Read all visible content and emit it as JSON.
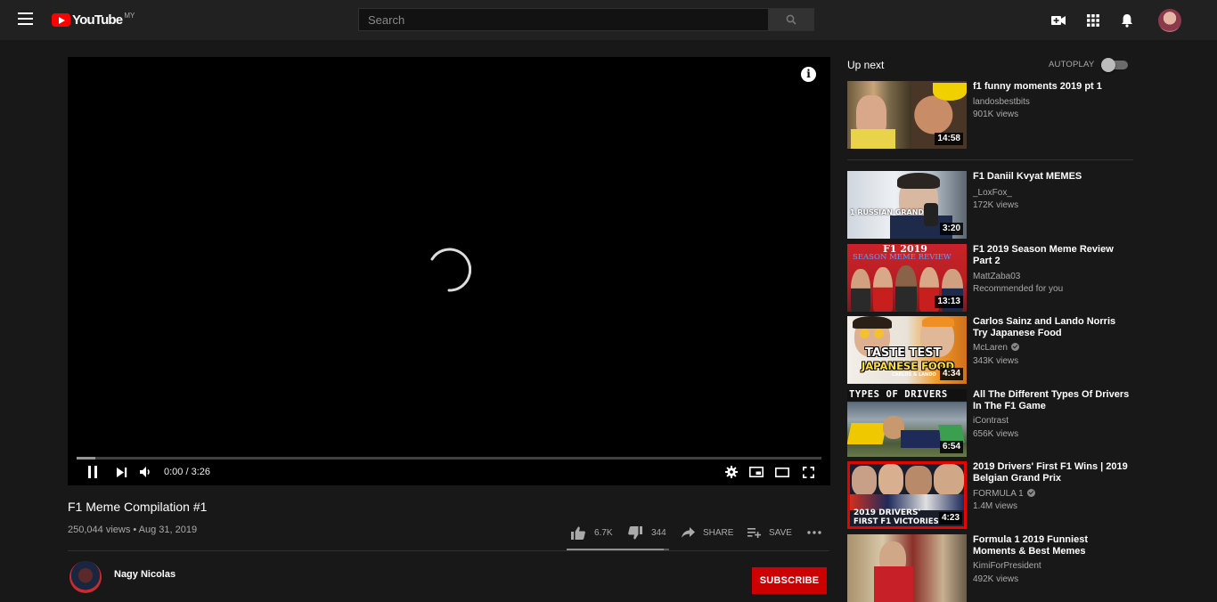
{
  "masthead": {
    "logo_text": "YouTube",
    "logo_region": "MY",
    "search_placeholder": "Search"
  },
  "player": {
    "time_display": "0:00 / 3:26",
    "progress_fraction": 0.0,
    "buffered_fraction": 0.025
  },
  "video": {
    "title": "F1 Meme Compilation #1",
    "meta": "250,044 views • Aug 31, 2019",
    "likes": "6.7K",
    "dislikes": "344",
    "like_ratio": 0.95,
    "share_label": "SHARE",
    "save_label": "SAVE"
  },
  "channel": {
    "name": "Nagy Nicolas",
    "subscribe_label": "SUBSCRIBE"
  },
  "sidebar": {
    "up_next_label": "Up next",
    "autoplay_label": "AUTOPLAY",
    "autoplay_on": false,
    "videos": [
      {
        "title": "f1 funny moments 2019 pt 1",
        "channel": "landosbestbits",
        "verified": false,
        "views": "901K views",
        "extra": "",
        "duration": "14:58"
      },
      {
        "title": "F1 Daniil Kvyat MEMES",
        "channel": "_LoxFox_",
        "verified": false,
        "views": "172K views",
        "extra": "",
        "duration": "3:20",
        "thumb_caption": "1 RUSSIAN GRAND"
      },
      {
        "title": "F1 2019 Season Meme Review Part 2",
        "channel": "MattZaba03",
        "verified": false,
        "views": "Recommended for you",
        "extra": "",
        "duration": "13:13",
        "thumb_caption": "F1 2019",
        "thumb_caption_2": "SEASON MEME REVIEW"
      },
      {
        "title": "Carlos Sainz and Lando Norris Try Japanese Food",
        "channel": "McLaren",
        "verified": true,
        "views": "343K views",
        "extra": "",
        "duration": "4:34",
        "thumb_caption": "TASTE TEST",
        "thumb_caption_2": "JAPANESE FOOD",
        "thumb_caption_3": "CARLOS & LANDO"
      },
      {
        "title": "All The Different Types Of Drivers In The F1 Game",
        "channel": "iContrast",
        "verified": false,
        "views": "656K views",
        "extra": "",
        "duration": "6:54",
        "thumb_caption": "TYPES OF DRIVERS"
      },
      {
        "title": "2019 Drivers' First F1 Wins | 2019 Belgian Grand Prix",
        "channel": "FORMULA 1",
        "verified": true,
        "views": "1.4M views",
        "extra": "",
        "duration": "4:23",
        "thumb_caption": "2019 DRIVERS'",
        "thumb_caption_2": "FIRST F1 VICTORIES"
      },
      {
        "title": "Formula 1 2019 Funniest Moments & Best Memes",
        "channel": "KimiForPresident",
        "verified": false,
        "views": "492K views",
        "extra": "",
        "duration": ""
      }
    ]
  }
}
